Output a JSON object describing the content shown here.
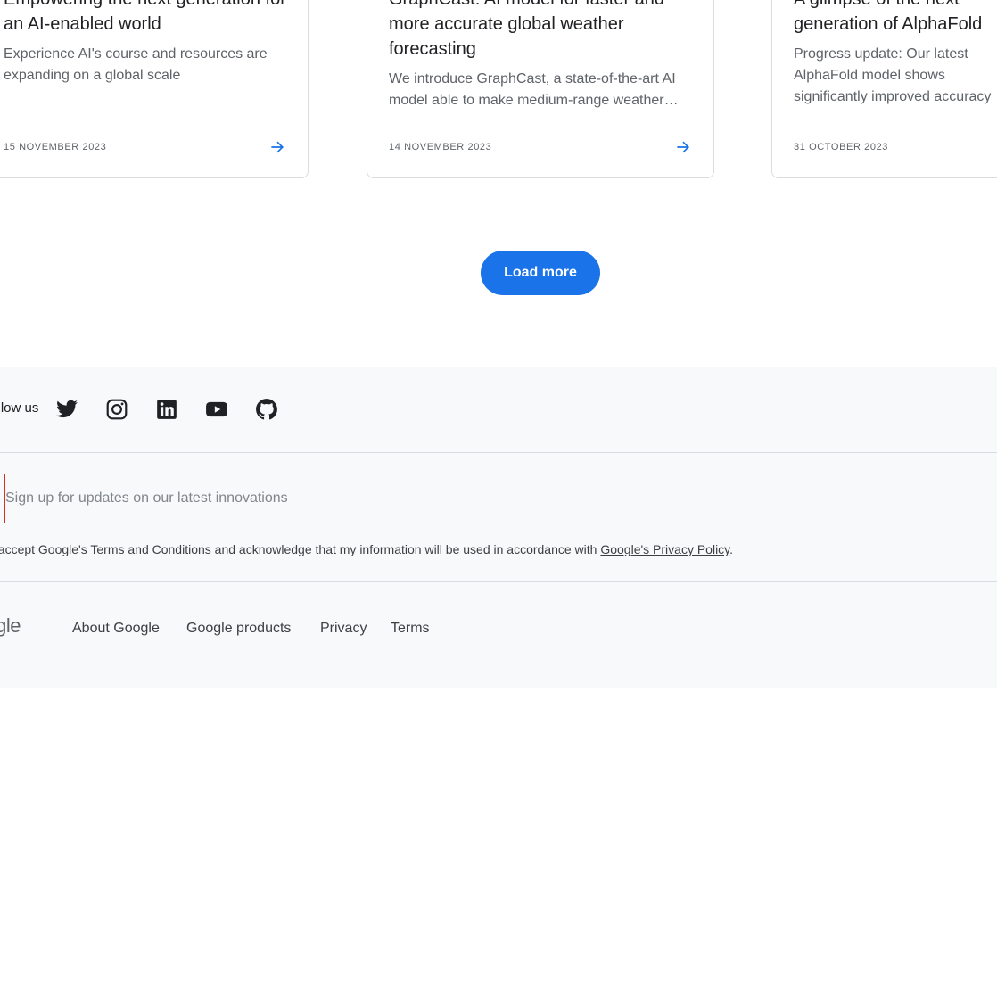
{
  "cards": [
    {
      "title": "Empowering the next generation for an AI-enabled world",
      "description": "Experience AI's course and resources are expanding on a global scale",
      "date": "15 NOVEMBER 2023"
    },
    {
      "title": "GraphCast: AI model for faster and more accurate global weather forecasting",
      "description": "We introduce GraphCast, a state-of-the-art AI model able to make medium-range weather…",
      "date": "14 NOVEMBER 2023"
    },
    {
      "title": "A glimpse of the next generation of AlphaFold",
      "description": "Progress update: Our latest AlphaFold model shows significantly improved accuracy",
      "date": "31 OCTOBER 2023"
    }
  ],
  "load_more_label": "Load more",
  "footer": {
    "follow_label": "Follow us",
    "social_icons": [
      "twitter-icon",
      "instagram-icon",
      "linkedin-icon",
      "youtube-icon",
      "github-icon"
    ],
    "signup_placeholder": "Sign up for updates on our latest innovations",
    "consent_text": "I accept Google's Terms and Conditions and acknowledge that my information will be used in accordance with ",
    "privacy_link": "Google's Privacy Policy",
    "consent_end": ".",
    "logo_text": "Google",
    "links": [
      "About Google",
      "Google products",
      "Privacy",
      "Terms"
    ]
  },
  "colors": {
    "accent": "#1a73e8",
    "footer_bg": "#f8f9fa",
    "input_border": "#d93025"
  }
}
